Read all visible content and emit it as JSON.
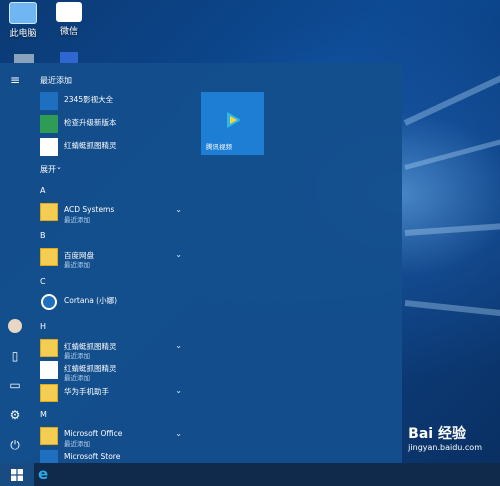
{
  "desktop": {
    "icons": [
      {
        "label": "此电脑"
      },
      {
        "label": "微信"
      }
    ]
  },
  "start_menu": {
    "recent_header": "最近添加",
    "recent_items": [
      {
        "label": "2345影视大全"
      },
      {
        "label": "检查升级新版本"
      },
      {
        "label": "红蜻蜓抓图精灵"
      }
    ],
    "expand_label": "展开",
    "groups": [
      {
        "letter": "A",
        "items": [
          {
            "label": "ACD Systems",
            "sub": "最近添加"
          }
        ]
      },
      {
        "letter": "B",
        "items": [
          {
            "label": "百度网盘",
            "sub": "最近添加"
          }
        ]
      },
      {
        "letter": "C",
        "items": [
          {
            "label": "Cortana (小娜)"
          }
        ]
      },
      {
        "letter": "H",
        "items": [
          {
            "label": "红蜻蜓抓图精灵",
            "sub": "最近添加"
          },
          {
            "label": "红蜻蜓抓图精灵",
            "sub": "最近添加"
          },
          {
            "label": "华为手机助手"
          }
        ]
      },
      {
        "letter": "M",
        "items": [
          {
            "label": "Microsoft Office",
            "sub": "最近添加"
          },
          {
            "label": "Microsoft Store"
          }
        ]
      }
    ],
    "tile": {
      "label": "腾讯视频"
    }
  },
  "watermark": {
    "main": "Bai 经验",
    "sub": "jingyan.baidu.com"
  },
  "colors": {
    "accent": "#1d7ed4",
    "menu_bg": "#144e8c",
    "taskbar_bg": "#0f2a4a"
  }
}
